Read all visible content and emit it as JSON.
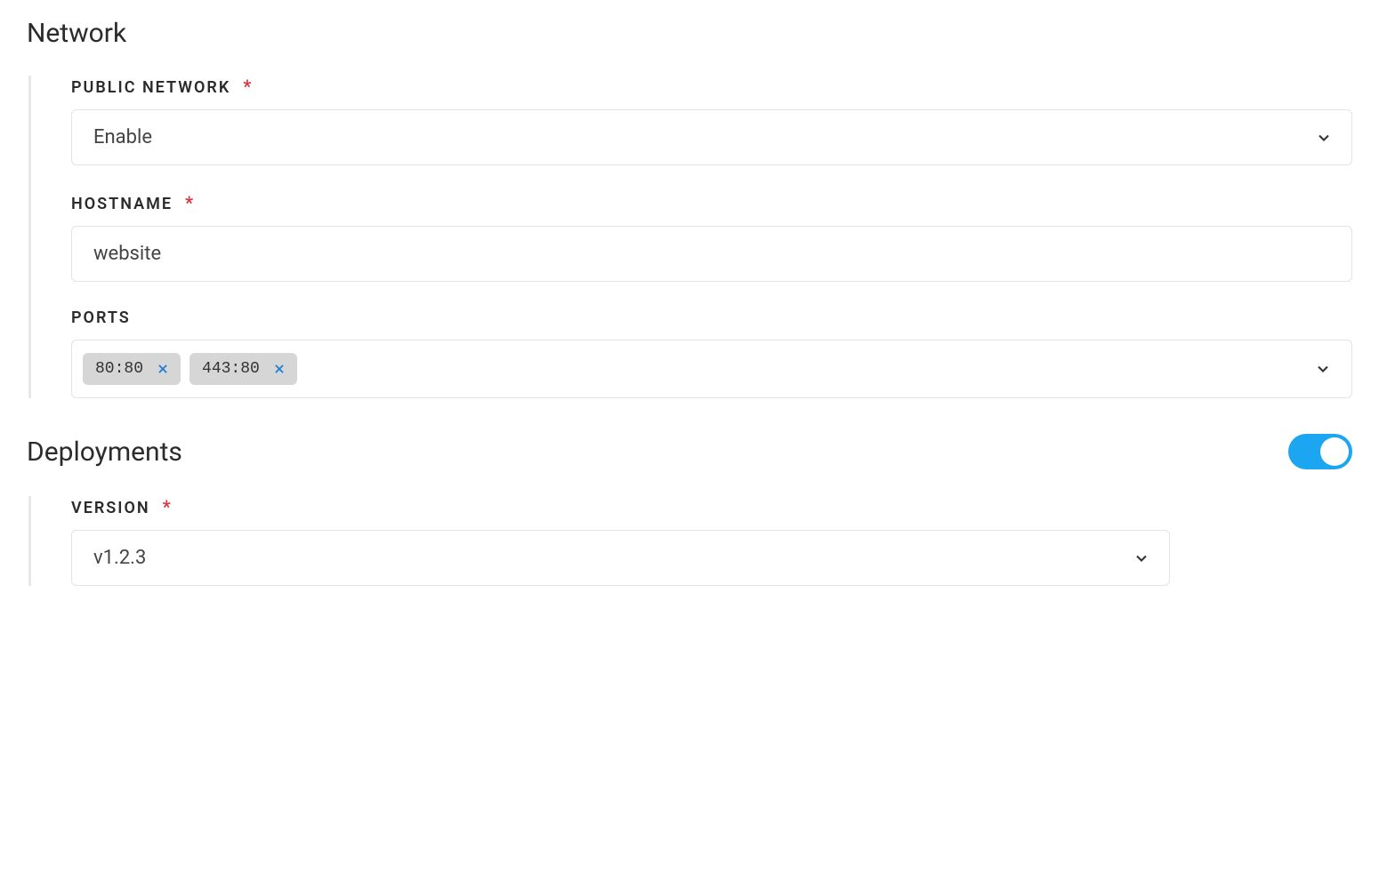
{
  "network": {
    "title": "Network",
    "public_network": {
      "label": "PUBLIC NETWORK",
      "required_mark": "*",
      "value": "Enable"
    },
    "hostname": {
      "label": "HOSTNAME",
      "required_mark": "*",
      "value": "website"
    },
    "ports": {
      "label": "PORTS",
      "tags": [
        "80:80",
        "443:80"
      ]
    }
  },
  "deployments": {
    "title": "Deployments",
    "enabled": true,
    "version": {
      "label": "VERSION",
      "required_mark": "*",
      "value": "v1.2.3"
    }
  }
}
